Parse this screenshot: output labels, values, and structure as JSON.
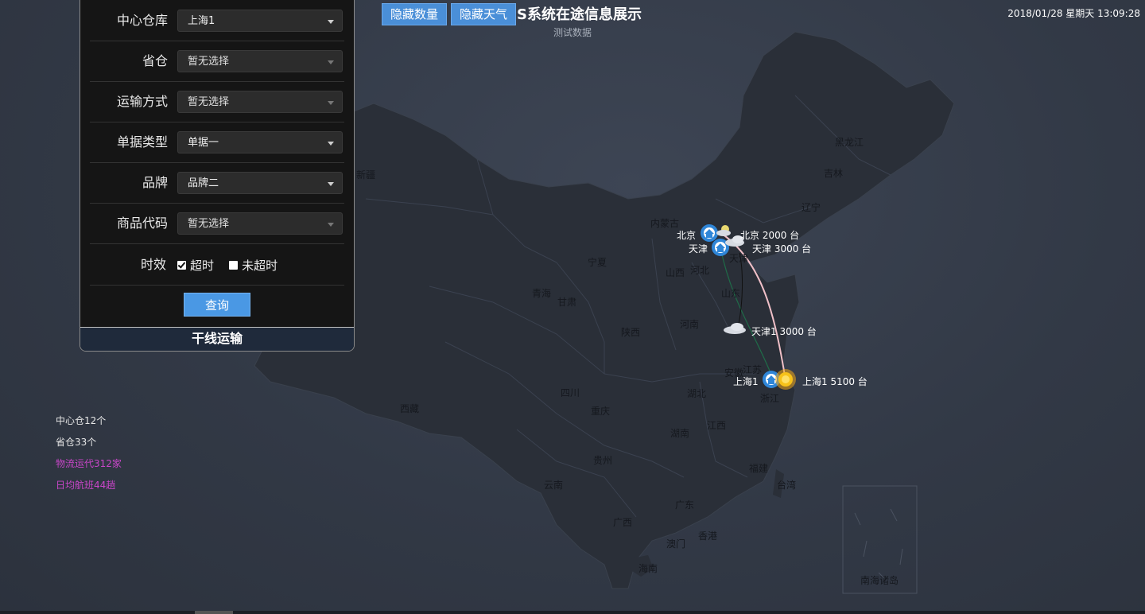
{
  "header": {
    "title": "S系统在途信息展示",
    "subtitle": "测试数据",
    "datetime": "2018/01/28 星期天 13:09:28",
    "btn_hide_count": "隐藏数量",
    "btn_hide_weather": "隐藏天气"
  },
  "filters": [
    {
      "label": "中心仓库",
      "value": "上海1"
    },
    {
      "label": "省仓",
      "value": "暂无选择"
    },
    {
      "label": "运输方式",
      "value": "暂无选择"
    },
    {
      "label": "单据类型",
      "value": "单据一"
    },
    {
      "label": "品牌",
      "value": "品牌二"
    },
    {
      "label": "商品代码",
      "value": "暂无选择"
    }
  ],
  "timeliness": {
    "label": "时效",
    "opt_overtime": "超时",
    "opt_not_overtime": "未超时",
    "overtime_checked": true,
    "not_overtime_checked": false
  },
  "query_button": "查询",
  "panel_footer": "干线运输",
  "stats": {
    "center_warehouses": "中心仓12个",
    "province_warehouses": "省仓33个",
    "carriers": "物流运代312家",
    "daily_flights": "日均航班44趟",
    "accent_color": "#c846c8"
  },
  "provinces": {
    "heilongjiang": "黑龙江",
    "jilin": "吉林",
    "liaoning": "辽宁",
    "neimenggu": "内蒙古",
    "xinjiang": "新疆",
    "ningxia": "宁夏",
    "qinghai": "青海",
    "gansu": "甘肃",
    "shanxi": "山西",
    "hebei": "河北",
    "tianjin": "天津",
    "shandong": "山东",
    "shaanxi": "陕西",
    "henan": "河南",
    "jiangsu": "江苏",
    "anhui": "安徽",
    "sichuan": "四川",
    "chongqing": "重庆",
    "hubei": "湖北",
    "zhejiang": "浙江",
    "xizang": "西藏",
    "hunan": "湖南",
    "jiangxi": "江西",
    "guizhou": "贵州",
    "fujian": "福建",
    "taiwan": "台湾",
    "yunnan": "云南",
    "guangdong": "广东",
    "guangxi": "广西",
    "xianggang": "香港",
    "aomen": "澳门",
    "hainan": "海南",
    "nanhai": "南海诸岛"
  },
  "cities": {
    "beijing_name": "北京",
    "beijing_count": "北京 2000 台",
    "tianjin_name": "天津",
    "tianjin_count": "天津 3000 台",
    "tianjin1_count": "天津1 3000 台",
    "shanghai_name": "上海1",
    "shanghai_count": "上海1 5100 台"
  },
  "icons": {
    "warehouse": "warehouse-pin-icon",
    "cloudy": "cloud-icon",
    "sunny": "sun-icon",
    "partly_cloudy": "sun-cloud-icon"
  }
}
